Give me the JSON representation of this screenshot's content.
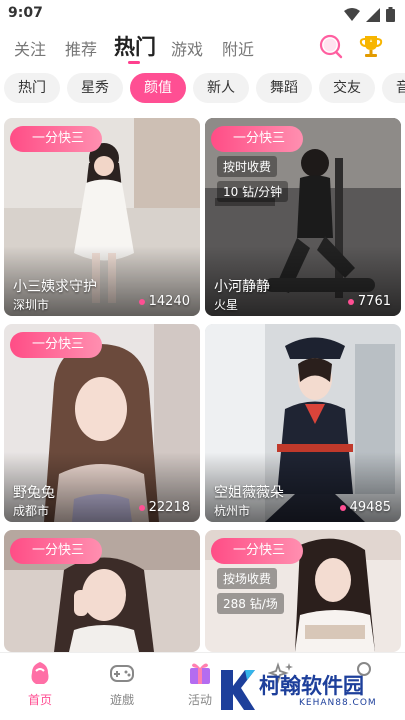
{
  "status": {
    "time": "9:07"
  },
  "top_tabs": [
    {
      "label": "关注"
    },
    {
      "label": "推荐"
    },
    {
      "label": "热门"
    },
    {
      "label": "游戏"
    },
    {
      "label": "附近"
    }
  ],
  "top_icons": [
    "search-icon",
    "trophy-icon"
  ],
  "chips": [
    {
      "label": "热门"
    },
    {
      "label": "星秀"
    },
    {
      "label": "颜值"
    },
    {
      "label": "新人"
    },
    {
      "label": "舞蹈"
    },
    {
      "label": "交友"
    },
    {
      "label": "音"
    }
  ],
  "cards": [
    {
      "badge": "一分快三",
      "name": "小三姨求守护",
      "city": "深圳市",
      "count": "14240",
      "price": "",
      "price2": ""
    },
    {
      "badge": "一分快三",
      "name": "小河静静",
      "city": "火星",
      "count": "7761",
      "price": "按时收费",
      "price2": "10 钻/分钟"
    },
    {
      "badge": "一分快三",
      "name": "野兔兔",
      "city": "成都市",
      "count": "22218",
      "price": "",
      "price2": ""
    },
    {
      "badge": "一分快三",
      "name": "空姐薇薇朵",
      "city": "杭州市",
      "count": "49485",
      "price": "",
      "price2": ""
    },
    {
      "badge": "一分快三",
      "name": "",
      "city": "",
      "count": "",
      "price": "",
      "price2": ""
    },
    {
      "badge": "一分快三",
      "name": "",
      "city": "",
      "count": "",
      "price": "按场收费",
      "price2": "288 钻/场"
    }
  ],
  "bottom_nav": [
    {
      "label": "首页",
      "icon": "home-icon"
    },
    {
      "label": "遊戲",
      "icon": "gamepad-icon"
    },
    {
      "label": "活动",
      "icon": "gift-icon"
    },
    {
      "label": "",
      "icon": "sparkle-icon"
    },
    {
      "label": "",
      "icon": "profile-icon"
    }
  ],
  "watermark": {
    "text": "柯翰软件园",
    "sub": "KEHAN88.COM"
  },
  "colors": {
    "accent": "#ff4f93",
    "badge_start": "#ff4d86",
    "badge_end": "#ff8fb0",
    "watermark": "#1d3f9b"
  }
}
